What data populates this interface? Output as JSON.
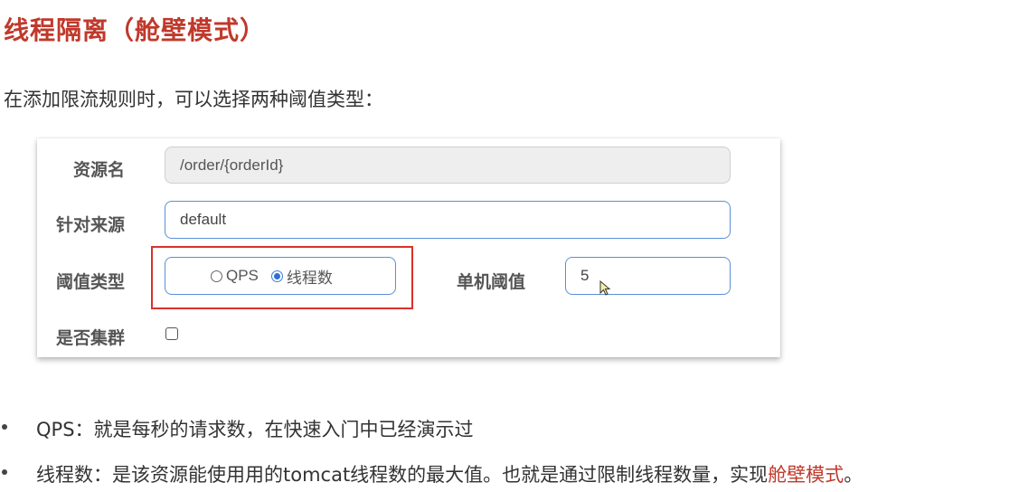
{
  "title": "线程隔离（舱壁模式）",
  "intro": "在添加限流规则时，可以选择两种阈值类型：",
  "form": {
    "resource_label": "资源名",
    "resource_value": "/order/{orderId}",
    "source_label": "针对来源",
    "source_value": "default",
    "threshold_type_label": "阈值类型",
    "options": [
      {
        "label": "QPS",
        "checked": false
      },
      {
        "label": "线程数",
        "checked": true
      }
    ],
    "single_threshold_label": "单机阈值",
    "single_threshold_value": "5",
    "cluster_label": "是否集群",
    "cluster_checked": false
  },
  "bullets": [
    {
      "text": "QPS：就是每秒的请求数，在快速入门中已经演示过"
    },
    {
      "text_before": "线程数：是该资源能使用用的tomcat线程数的最大值。也就是通过限制线程数量，实现",
      "highlight": "舱壁模式",
      "text_after": "。"
    }
  ],
  "colors": {
    "title": "#c0392b",
    "highlight_box": "#d9322b",
    "field_border": "#5b8fd6",
    "radio_checked": "#2f6fd6"
  }
}
